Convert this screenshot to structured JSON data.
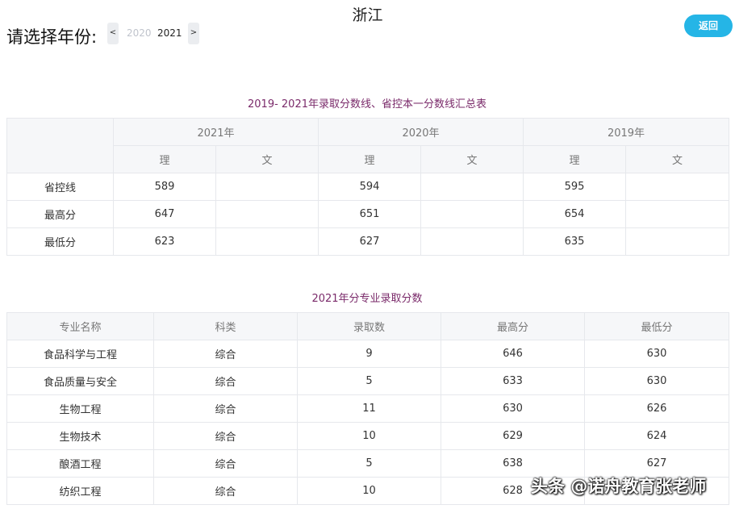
{
  "page": {
    "province": "浙江",
    "back_label": "返回",
    "year_prompt": "请选择年份:",
    "year_prev": "<",
    "year_next": ">",
    "years": [
      "2020",
      "2021"
    ],
    "selected_year": "2021"
  },
  "summary": {
    "title": "2019- 2021年录取分数线、省控本一分数线汇总表",
    "years": [
      "2021年",
      "2020年",
      "2019年"
    ],
    "subjects": [
      "理",
      "文",
      "理",
      "文",
      "理",
      "文"
    ],
    "rows": [
      {
        "label": "省控线",
        "values": [
          "589",
          "",
          "594",
          "",
          "595",
          ""
        ]
      },
      {
        "label": "最高分",
        "values": [
          "647",
          "",
          "651",
          "",
          "654",
          ""
        ]
      },
      {
        "label": "最低分",
        "values": [
          "623",
          "",
          "627",
          "",
          "635",
          ""
        ]
      }
    ]
  },
  "majors": {
    "title": "2021年分专业录取分数",
    "headers": [
      "专业名称",
      "科类",
      "录取数",
      "最高分",
      "最低分"
    ],
    "rows": [
      [
        "食品科学与工程",
        "综合",
        "9",
        "646",
        "630"
      ],
      [
        "食品质量与安全",
        "综合",
        "5",
        "633",
        "630"
      ],
      [
        "生物工程",
        "综合",
        "11",
        "630",
        "626"
      ],
      [
        "生物技术",
        "综合",
        "10",
        "629",
        "624"
      ],
      [
        "酿酒工程",
        "综合",
        "5",
        "638",
        "627"
      ],
      [
        "纺织工程",
        "综合",
        "10",
        "628",
        ""
      ]
    ]
  },
  "watermark": "头条 @诺舟教育张老师"
}
